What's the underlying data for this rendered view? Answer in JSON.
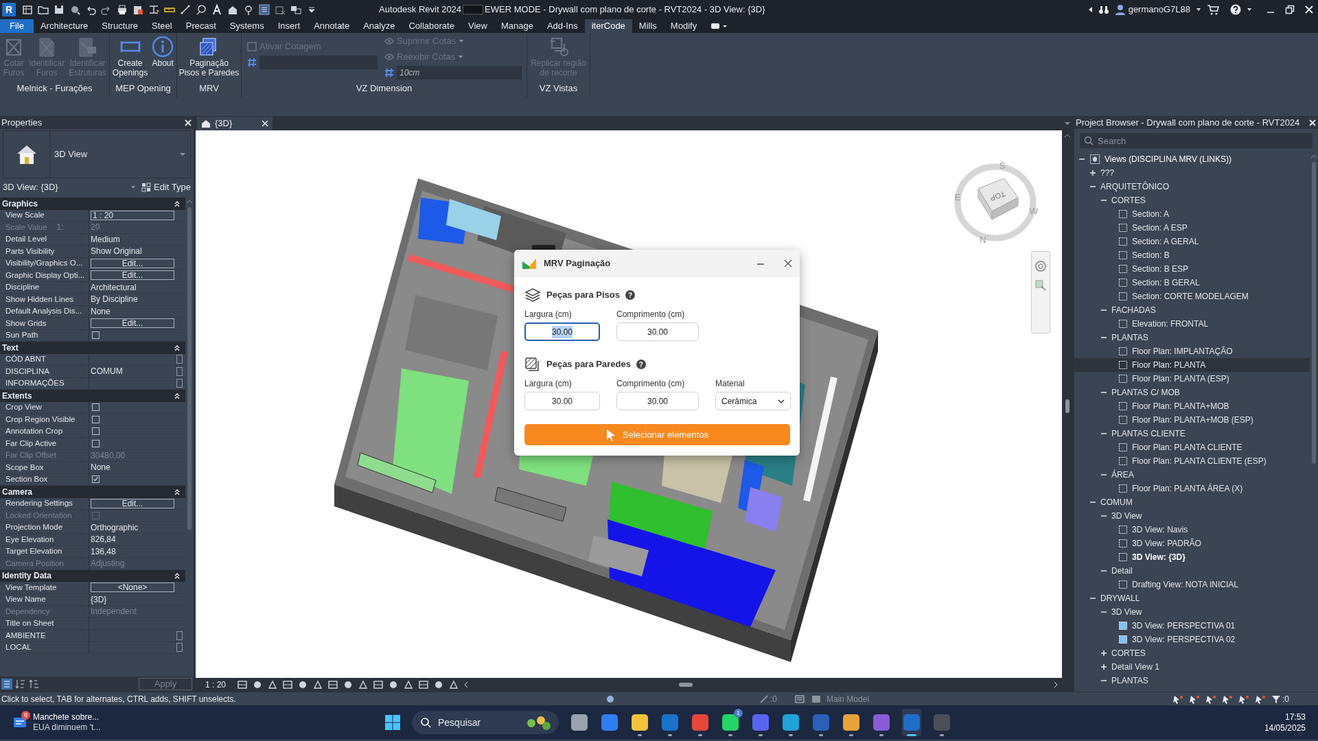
{
  "title_bar": {
    "app_logo": "R",
    "title_parts": [
      "Autodesk Revit 2024",
      "EWER MODE - Drywall com plano de corte - RVT2024 - 3D View: {3D}"
    ],
    "user": "germanoG7L88"
  },
  "ribbon_tabs": [
    {
      "label": "File",
      "kind": "file",
      "selected": false
    },
    {
      "label": "Architecture",
      "kind": "tab",
      "selected": false
    },
    {
      "label": "Structure",
      "kind": "tab",
      "selected": false
    },
    {
      "label": "Steel",
      "kind": "tab",
      "selected": false
    },
    {
      "label": "Precast",
      "kind": "tab",
      "selected": false
    },
    {
      "label": "Systems",
      "kind": "tab",
      "selected": false
    },
    {
      "label": "Insert",
      "kind": "tab",
      "selected": false
    },
    {
      "label": "Annotate",
      "kind": "tab",
      "selected": false
    },
    {
      "label": "Analyze",
      "kind": "tab",
      "selected": false
    },
    {
      "label": "Collaborate",
      "kind": "tab",
      "selected": false
    },
    {
      "label": "View",
      "kind": "tab",
      "selected": false
    },
    {
      "label": "Manage",
      "kind": "tab",
      "selected": false
    },
    {
      "label": "Add-Ins",
      "kind": "tab",
      "selected": false
    },
    {
      "label": "iterCode",
      "kind": "tab",
      "selected": true
    },
    {
      "label": "Mills",
      "kind": "tab",
      "selected": false
    },
    {
      "label": "Modify",
      "kind": "tab",
      "selected": false
    }
  ],
  "ribbon_panels": [
    {
      "label": "Melnick - Furações",
      "kind": "large",
      "tools": [
        {
          "label": "Cotar\nFuros",
          "disabled": true
        },
        {
          "label": "Identificar\nFuros",
          "disabled": true
        },
        {
          "label": "Identificar\nEstruturas",
          "disabled": true
        }
      ]
    },
    {
      "label": "MEP Opening",
      "kind": "large",
      "tools": [
        {
          "label": "Create\nOpenings",
          "disabled": false
        },
        {
          "label": "About",
          "disabled": false
        }
      ]
    },
    {
      "label": "MRV",
      "kind": "large",
      "tools": [
        {
          "label": "Paginação\nPisos e Paredes",
          "disabled": false
        }
      ]
    },
    {
      "label": "VZ Dimension",
      "kind": "columns",
      "columns": [
        [
          {
            "kind": "check",
            "label": "Ativar Cotagem",
            "disabled": true
          },
          {
            "kind": "field"
          }
        ],
        [
          {
            "kind": "dropdown",
            "label": "Suprimir Cotas",
            "disabled": true
          },
          {
            "kind": "dropdown",
            "label": "Reexibir Cotas",
            "disabled": true
          },
          {
            "kind": "field",
            "value": "10cm",
            "disabled": false
          }
        ]
      ]
    },
    {
      "label": "VZ Vistas",
      "kind": "large",
      "tools": [
        {
          "label": "Replicar região\nde recorte",
          "disabled": true
        }
      ]
    }
  ],
  "properties": {
    "title": "Properties",
    "type_name": "3D View",
    "instance": "3D View: {3D}",
    "edit_type": "Edit Type",
    "apply": "Apply",
    "groups": [
      {
        "name": "Graphics",
        "expanded": true,
        "rows": [
          {
            "label": "View Scale",
            "value": "1 : 20",
            "kind": "field",
            "disabled": false
          },
          {
            "label": "Scale Value",
            "note": "1:",
            "value": "20",
            "kind": "text",
            "disabled": true
          },
          {
            "label": "Detail Level",
            "value": "Medium",
            "kind": "text",
            "disabled": false
          },
          {
            "label": "Parts Visibility",
            "value": "Show Original",
            "kind": "text",
            "disabled": false
          },
          {
            "label": "Visibility/Graphics O...",
            "value": "Edit...",
            "kind": "button",
            "disabled": false
          },
          {
            "label": "Graphic Display Opti...",
            "value": "Edit...",
            "kind": "button",
            "disabled": false
          },
          {
            "label": "Discipline",
            "value": "Architectural",
            "kind": "text",
            "disabled": false
          },
          {
            "label": "Show Hidden Lines",
            "value": "By Discipline",
            "kind": "text",
            "disabled": false
          },
          {
            "label": "Default Analysis Dis...",
            "value": "None",
            "kind": "text",
            "disabled": false
          },
          {
            "label": "Show Grids",
            "value": "Edit...",
            "kind": "button",
            "disabled": false
          },
          {
            "label": "Sun Path",
            "kind": "checkbox",
            "checked": false,
            "disabled": false
          }
        ]
      },
      {
        "name": "Text",
        "expanded": true,
        "rows": [
          {
            "label": "CÓD ABNT",
            "kind": "param",
            "disabled": false
          },
          {
            "label": "DISCIPLINA",
            "value": "COMUM",
            "kind": "param",
            "disabled": false
          },
          {
            "label": "INFORMAÇÕES",
            "kind": "param",
            "disabled": false
          }
        ]
      },
      {
        "name": "Extents",
        "expanded": true,
        "rows": [
          {
            "label": "Crop View",
            "kind": "checkbox",
            "checked": false,
            "disabled": false
          },
          {
            "label": "Crop Region Visible",
            "kind": "checkbox",
            "checked": false,
            "disabled": false
          },
          {
            "label": "Annotation Crop",
            "kind": "checkbox",
            "checked": false,
            "disabled": false
          },
          {
            "label": "Far Clip Active",
            "kind": "checkbox",
            "checked": false,
            "disabled": false
          },
          {
            "label": "Far Clip Offset",
            "value": "30480,00",
            "kind": "text",
            "disabled": true
          },
          {
            "label": "Scope Box",
            "value": "None",
            "kind": "text",
            "disabled": false
          },
          {
            "label": "Section Box",
            "kind": "checkbox",
            "checked": true,
            "disabled": false
          }
        ]
      },
      {
        "name": "Camera",
        "expanded": true,
        "rows": [
          {
            "label": "Rendering Settings",
            "value": "Edit...",
            "kind": "button",
            "disabled": false
          },
          {
            "label": "Locked Orientation",
            "kind": "checkbox",
            "checked": false,
            "disabled": true
          },
          {
            "label": "Projection Mode",
            "value": "Orthographic",
            "kind": "text",
            "disabled": false
          },
          {
            "label": "Eye Elevation",
            "value": "826,84",
            "kind": "text",
            "disabled": false
          },
          {
            "label": "Target Elevation",
            "value": "136,48",
            "kind": "text",
            "disabled": false
          },
          {
            "label": "Camera Position",
            "value": "Adjusting",
            "kind": "text",
            "disabled": true
          }
        ]
      },
      {
        "name": "Identity Data",
        "expanded": true,
        "rows": [
          {
            "label": "View Template",
            "value": "<None>",
            "kind": "button",
            "disabled": false
          },
          {
            "label": "View Name",
            "value": "{3D}",
            "kind": "text",
            "disabled": false
          },
          {
            "label": "Dependency",
            "value": "Independent",
            "kind": "text",
            "disabled": true
          },
          {
            "label": "Title on Sheet",
            "kind": "text",
            "disabled": false
          },
          {
            "label": "AMBIENTE",
            "kind": "param",
            "disabled": false
          },
          {
            "label": "LOCAL",
            "kind": "param",
            "disabled": false
          }
        ]
      }
    ]
  },
  "view": {
    "tab": "{3D}",
    "scale": "1 : 20",
    "viewcube": {
      "face": "TOP",
      "north": "N",
      "south": "S",
      "east": "E",
      "west": "W"
    }
  },
  "dialog": {
    "title": "MRV Paginação",
    "help": "?",
    "sections": [
      {
        "title": "Peças para Pisos",
        "fields": [
          {
            "label": "Largura (cm)",
            "value": "30.00",
            "kind": "input",
            "focused": true
          },
          {
            "label": "Comprimento (cm)",
            "value": "30.00",
            "kind": "input",
            "focused": false
          }
        ]
      },
      {
        "title": "Peças para Paredes",
        "fields": [
          {
            "label": "Largura (cm)",
            "value": "30.00",
            "kind": "input",
            "focused": false
          },
          {
            "label": "Comprimento (cm)",
            "value": "30.00",
            "kind": "input",
            "focused": false
          },
          {
            "label": "Material",
            "value": "Cerâmica",
            "kind": "select",
            "focused": false
          }
        ]
      }
    ],
    "button": "Selecionar elementos"
  },
  "project_browser": {
    "title": "Project Browser - Drywall com plano de corte - RVT2024",
    "search_placeholder": "Search",
    "tree": [
      {
        "label": "Views (DISCIPLINA MRV (LINKS))",
        "kind": "root",
        "expanded": true,
        "selected": false,
        "children": [
          {
            "label": "???",
            "kind": "folder",
            "expanded": false,
            "selected": false
          },
          {
            "label": "ARQUITETÔNICO",
            "kind": "folder",
            "expanded": true,
            "selected": false,
            "children": [
              {
                "label": "CORTES",
                "kind": "folder",
                "expanded": true,
                "selected": false,
                "children": [
                  {
                    "label": "Section: A",
                    "kind": "view",
                    "selected": false,
                    "current": false,
                    "placed": false
                  },
                  {
                    "label": "Section: A ESP",
                    "kind": "view",
                    "selected": false,
                    "current": false,
                    "placed": false
                  },
                  {
                    "label": "Section: A GERAL",
                    "kind": "view",
                    "selected": false,
                    "current": false,
                    "placed": false
                  },
                  {
                    "label": "Section: B",
                    "kind": "view",
                    "selected": false,
                    "current": false,
                    "placed": false
                  },
                  {
                    "label": "Section: B ESP",
                    "kind": "view",
                    "selected": false,
                    "current": false,
                    "placed": false
                  },
                  {
                    "label": "Section: B GERAL",
                    "kind": "view",
                    "selected": false,
                    "current": false,
                    "placed": false
                  },
                  {
                    "label": "Section: CORTE MODELAGEM",
                    "kind": "view",
                    "selected": false,
                    "current": false,
                    "placed": false
                  }
                ]
              },
              {
                "label": "FACHADAS",
                "kind": "folder",
                "expanded": true,
                "selected": false,
                "children": [
                  {
                    "label": "Elevation: FRONTAL",
                    "kind": "view",
                    "selected": false,
                    "current": false,
                    "placed": false
                  }
                ]
              },
              {
                "label": "PLANTAS",
                "kind": "folder",
                "expanded": true,
                "selected": false,
                "children": [
                  {
                    "label": "Floor Plan: IMPLANTAÇÃO",
                    "kind": "view",
                    "selected": false,
                    "current": false,
                    "placed": false
                  },
                  {
                    "label": "Floor Plan: PLANTA",
                    "kind": "view",
                    "selected": true,
                    "current": false,
                    "placed": false
                  },
                  {
                    "label": "Floor Plan: PLANTA (ESP)",
                    "kind": "view",
                    "selected": false,
                    "current": false,
                    "placed": false
                  }
                ]
              },
              {
                "label": "PLANTAS C/ MOB",
                "kind": "folder",
                "expanded": true,
                "selected": false,
                "children": [
                  {
                    "label": "Floor Plan: PLANTA+MOB",
                    "kind": "view",
                    "selected": false,
                    "current": false,
                    "placed": false
                  },
                  {
                    "label": "Floor Plan: PLANTA+MOB (ESP)",
                    "kind": "view",
                    "selected": false,
                    "current": false,
                    "placed": false
                  }
                ]
              },
              {
                "label": "PLANTAS CLIENTE",
                "kind": "folder",
                "expanded": true,
                "selected": false,
                "children": [
                  {
                    "label": "Floor Plan: PLANTA CLIENTE",
                    "kind": "view",
                    "selected": false,
                    "current": false,
                    "placed": false
                  },
                  {
                    "label": "Floor Plan: PLANTA CLIENTE (ESP)",
                    "kind": "view",
                    "selected": false,
                    "current": false,
                    "placed": false
                  }
                ]
              },
              {
                "label": "ÁREA",
                "kind": "folder",
                "expanded": true,
                "selected": false,
                "children": [
                  {
                    "label": "Floor Plan: PLANTA ÁREA (X)",
                    "kind": "view",
                    "selected": false,
                    "current": false,
                    "placed": false
                  }
                ]
              }
            ]
          },
          {
            "label": "COMUM",
            "kind": "folder",
            "expanded": true,
            "selected": false,
            "children": [
              {
                "label": "3D View",
                "kind": "folder",
                "expanded": true,
                "selected": false,
                "children": [
                  {
                    "label": "3D View: Navis",
                    "kind": "view",
                    "selected": false,
                    "current": false,
                    "placed": false
                  },
                  {
                    "label": "3D View: PADRÃO",
                    "kind": "view",
                    "selected": false,
                    "current": false,
                    "placed": false
                  },
                  {
                    "label": "3D View: {3D}",
                    "kind": "view",
                    "selected": false,
                    "current": true,
                    "placed": false
                  }
                ]
              },
              {
                "label": "Detail",
                "kind": "folder",
                "expanded": true,
                "selected": false,
                "children": [
                  {
                    "label": "Drafting View: NOTA INICIAL",
                    "kind": "view",
                    "selected": false,
                    "current": false,
                    "placed": false
                  }
                ]
              }
            ]
          },
          {
            "label": "DRYWALL",
            "kind": "folder",
            "expanded": true,
            "selected": false,
            "children": [
              {
                "label": "3D View",
                "kind": "folder",
                "expanded": true,
                "selected": false,
                "children": [
                  {
                    "label": "3D View: PERSPECTIVA 01",
                    "kind": "view",
                    "selected": false,
                    "current": false,
                    "placed": true
                  },
                  {
                    "label": "3D View: PERSPECTIVA 02",
                    "kind": "view",
                    "selected": false,
                    "current": false,
                    "placed": true
                  }
                ]
              },
              {
                "label": "CORTES",
                "kind": "folder",
                "expanded": false,
                "selected": false
              },
              {
                "label": "Detail View 1",
                "kind": "folder",
                "expanded": false,
                "selected": false
              },
              {
                "label": "PLANTAS",
                "kind": "folder",
                "expanded": true,
                "selected": false
              }
            ]
          }
        ]
      }
    ]
  },
  "status_bar": {
    "message": "Click to select, TAB for alternates, CTRL adds, SHIFT unselects.",
    "worksets": ":0",
    "model": "Main Model",
    "filter": ":0"
  },
  "taskbar": {
    "news_badge": "8",
    "news_title": "Manchete sobre...",
    "news_text": "EUA diminuem 't...",
    "search_placeholder": "Pesquisar",
    "time": "17:53",
    "date": "14/05/2025",
    "apps": [
      {
        "color": "#9aa3ad",
        "running": false,
        "active": false
      },
      {
        "color": "#2f7ef0",
        "running": false,
        "active": false
      },
      {
        "color": "#f3c33c",
        "running": true,
        "active": false
      },
      {
        "color": "#1a73c8",
        "running": true,
        "active": false
      },
      {
        "color": "#e9463a",
        "running": true,
        "active": false
      },
      {
        "color": "#25d366",
        "running": true,
        "active": false,
        "badge": "1"
      },
      {
        "color": "#5865f2",
        "running": true,
        "active": false
      },
      {
        "color": "#1fa3d8",
        "running": true,
        "active": false
      },
      {
        "color": "#2b5fb8",
        "running": true,
        "active": false
      },
      {
        "color": "#e9a23a",
        "running": true,
        "active": false
      },
      {
        "color": "#8a5bd6",
        "running": true,
        "active": false
      },
      {
        "color": "#1f6ec8",
        "running": true,
        "active": true
      },
      {
        "color": "#4a4f58",
        "running": true,
        "active": false
      }
    ]
  }
}
